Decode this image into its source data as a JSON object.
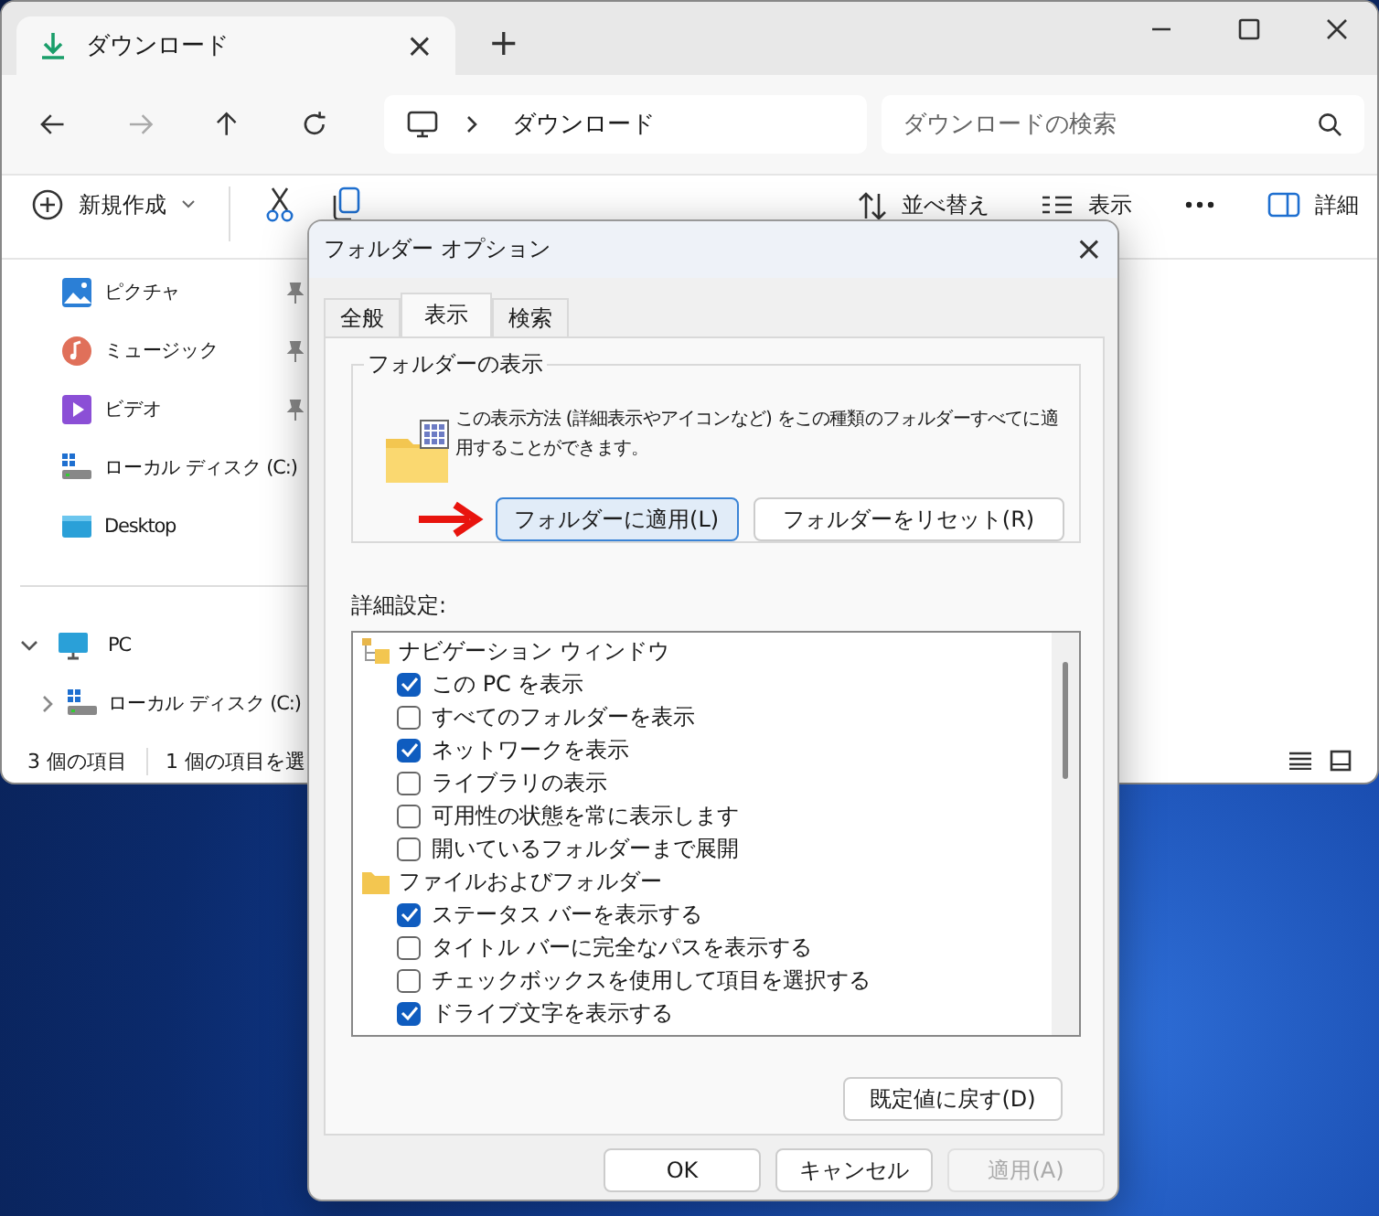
{
  "explorer": {
    "tab": {
      "title": "ダウンロード",
      "close": "×"
    },
    "new_tab": "+",
    "address": {
      "path": "ダウンロード"
    },
    "search": {
      "placeholder": "ダウンロードの検索"
    },
    "toolbar": {
      "new": "新規作成",
      "sort": "並べ替え",
      "view": "表示",
      "details": "詳細"
    },
    "sidebar": {
      "items": [
        {
          "label": "ピクチャ",
          "kind": "pictures",
          "pinned": true
        },
        {
          "label": "ミュージック",
          "kind": "music",
          "pinned": true
        },
        {
          "label": "ビデオ",
          "kind": "videos",
          "pinned": true
        },
        {
          "label": "ローカル ディスク (C:)",
          "kind": "drive",
          "pinned": false
        },
        {
          "label": "Desktop",
          "kind": "desktop",
          "pinned": false
        }
      ],
      "tree": [
        {
          "label": "PC",
          "kind": "pc",
          "expanded": true,
          "children": [
            {
              "label": "ローカル ディスク (C:)",
              "kind": "drive",
              "expanded": false
            }
          ]
        }
      ]
    },
    "status_bar": {
      "count": "3 個の項目",
      "selection": "1 個の項目を選"
    }
  },
  "dialog": {
    "title": "フォルダー オプション",
    "close": "×",
    "tabs": [
      {
        "label": "全般",
        "selected": false
      },
      {
        "label": "表示",
        "selected": true
      },
      {
        "label": "検索",
        "selected": false
      }
    ],
    "folder_views": {
      "legend": "フォルダーの表示",
      "description": "この表示方法 (詳細表示やアイコンなど) をこの種類のフォルダーすべてに適用することができます。",
      "buttons": [
        {
          "label": "フォルダーに適用(L)",
          "highlighted": true
        },
        {
          "label": "フォルダーをリセット(R)",
          "highlighted": false
        }
      ]
    },
    "advanced": {
      "label": "詳細設定:",
      "items": [
        {
          "label": "ナビゲーション ウィンドウ",
          "kind": "nav",
          "children": [
            {
              "label": "この PC を表示",
              "checked": true
            },
            {
              "label": "すべてのフォルダーを表示",
              "checked": false
            },
            {
              "label": "ネットワークを表示",
              "checked": true
            },
            {
              "label": "ライブラリの表示",
              "checked": false
            },
            {
              "label": "可用性の状態を常に表示します",
              "checked": false
            },
            {
              "label": "開いているフォルダーまで展開",
              "checked": false
            }
          ]
        },
        {
          "label": "ファイルおよびフォルダー",
          "kind": "folder",
          "children": [
            {
              "label": "ステータス バーを表示する",
              "checked": true
            },
            {
              "label": "タイトル バーに完全なパスを表示する",
              "checked": false
            },
            {
              "label": "チェックボックスを使用して項目を選択する",
              "checked": false
            },
            {
              "label": "ドライブ文字を表示する",
              "checked": true
            }
          ]
        }
      ],
      "restore": "既定値に戻す(D)"
    },
    "buttons": [
      {
        "label": "OK",
        "disabled": false
      },
      {
        "label": "キャンセル",
        "disabled": false
      },
      {
        "label": "適用(A)",
        "disabled": true
      }
    ]
  }
}
